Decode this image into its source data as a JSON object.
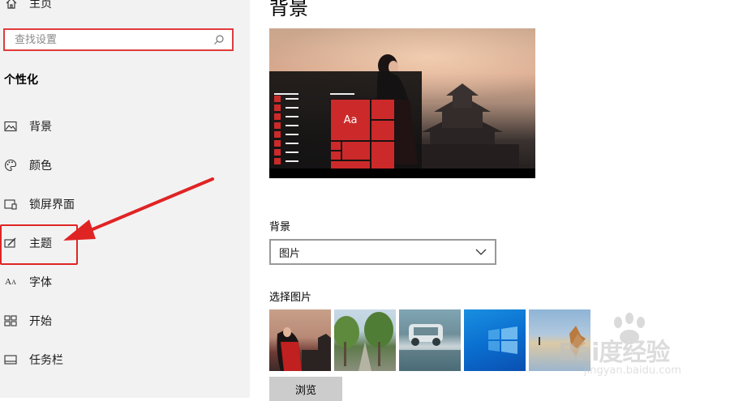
{
  "sidebar": {
    "home_label": "主页",
    "search_placeholder": "查找设置",
    "section_title": "个性化",
    "items": [
      {
        "label": "背景",
        "icon": "picture-icon"
      },
      {
        "label": "颜色",
        "icon": "palette-icon"
      },
      {
        "label": "锁屏界面",
        "icon": "lock-screen-icon"
      },
      {
        "label": "主题",
        "icon": "theme-icon"
      },
      {
        "label": "字体",
        "icon": "font-icon"
      },
      {
        "label": "开始",
        "icon": "start-icon"
      },
      {
        "label": "任务栏",
        "icon": "taskbar-icon"
      }
    ]
  },
  "main": {
    "title": "背景",
    "preview_tile_text": "Aa",
    "background_label": "背景",
    "background_value": "图片",
    "choose_label": "选择图片",
    "browse_label": "浏览",
    "thumbnails": [
      "thumbnail-1",
      "thumbnail-2",
      "thumbnail-3",
      "thumbnail-4",
      "thumbnail-5"
    ]
  },
  "watermark": {
    "main": "Bai度经验",
    "sub": "jingyan.baidu.com"
  },
  "colors": {
    "highlight": "#e02424",
    "accent": "#cc2a2a",
    "sidebar_bg": "#f2f2f2"
  }
}
